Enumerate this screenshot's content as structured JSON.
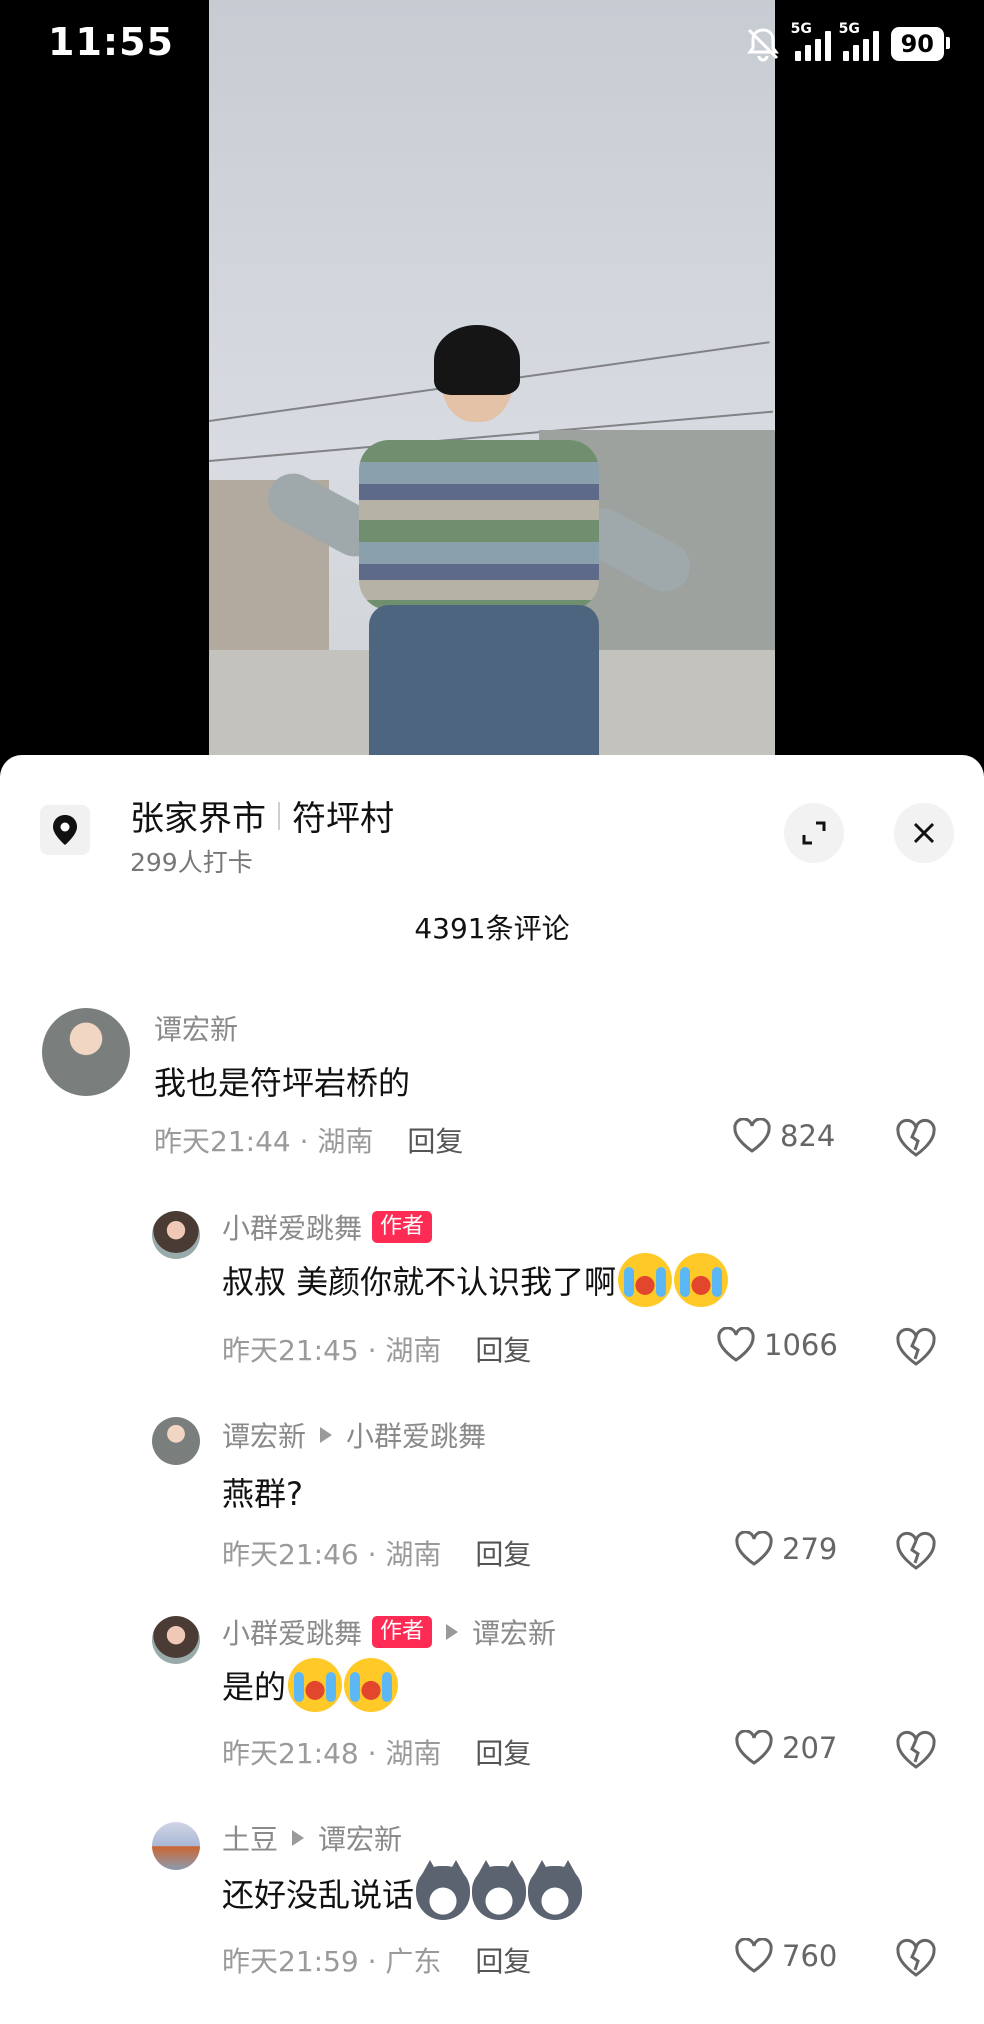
{
  "status_bar": {
    "time": "11:55",
    "battery": "90",
    "net1": "5G",
    "net2": "5G"
  },
  "location": {
    "city": "张家界市",
    "place": "符坪村",
    "checkins": "299人打卡"
  },
  "comments_count": "4391条评论",
  "comments": [
    {
      "user": "谭宏新",
      "text": "我也是符坪岩桥的",
      "time": "昨天21:44 · 湖南",
      "reply": "回复",
      "likes": "824"
    },
    {
      "user": "小群爱跳舞",
      "author_badge": "作者",
      "text": "叔叔 美颜你就不认识我了啊",
      "time": "昨天21:45 · 湖南",
      "reply": "回复",
      "likes": "1066",
      "emoji": [
        "cry-laugh-emoji",
        "cry-laugh-emoji"
      ]
    },
    {
      "user": "谭宏新",
      "reply_to": "小群爱跳舞",
      "text": "燕群?",
      "time": "昨天21:46 · 湖南",
      "reply": "回复",
      "likes": "279"
    },
    {
      "user": "小群爱跳舞",
      "author_badge": "作者",
      "reply_to": "谭宏新",
      "text": "是的",
      "time": "昨天21:48 · 湖南",
      "reply": "回复",
      "likes": "207",
      "emoji": [
        "cry-laugh-emoji",
        "cry-laugh-emoji"
      ]
    },
    {
      "user": "土豆",
      "reply_to": "谭宏新",
      "text": "还好没乱说话",
      "time": "昨天21:59 · 广东",
      "reply": "回复",
      "likes": "760",
      "emoji": [
        "husky-emoji",
        "husky-emoji",
        "husky-emoji"
      ]
    }
  ],
  "colors": {
    "badge": "#fe2c55",
    "muted": "#8a8a8a"
  }
}
